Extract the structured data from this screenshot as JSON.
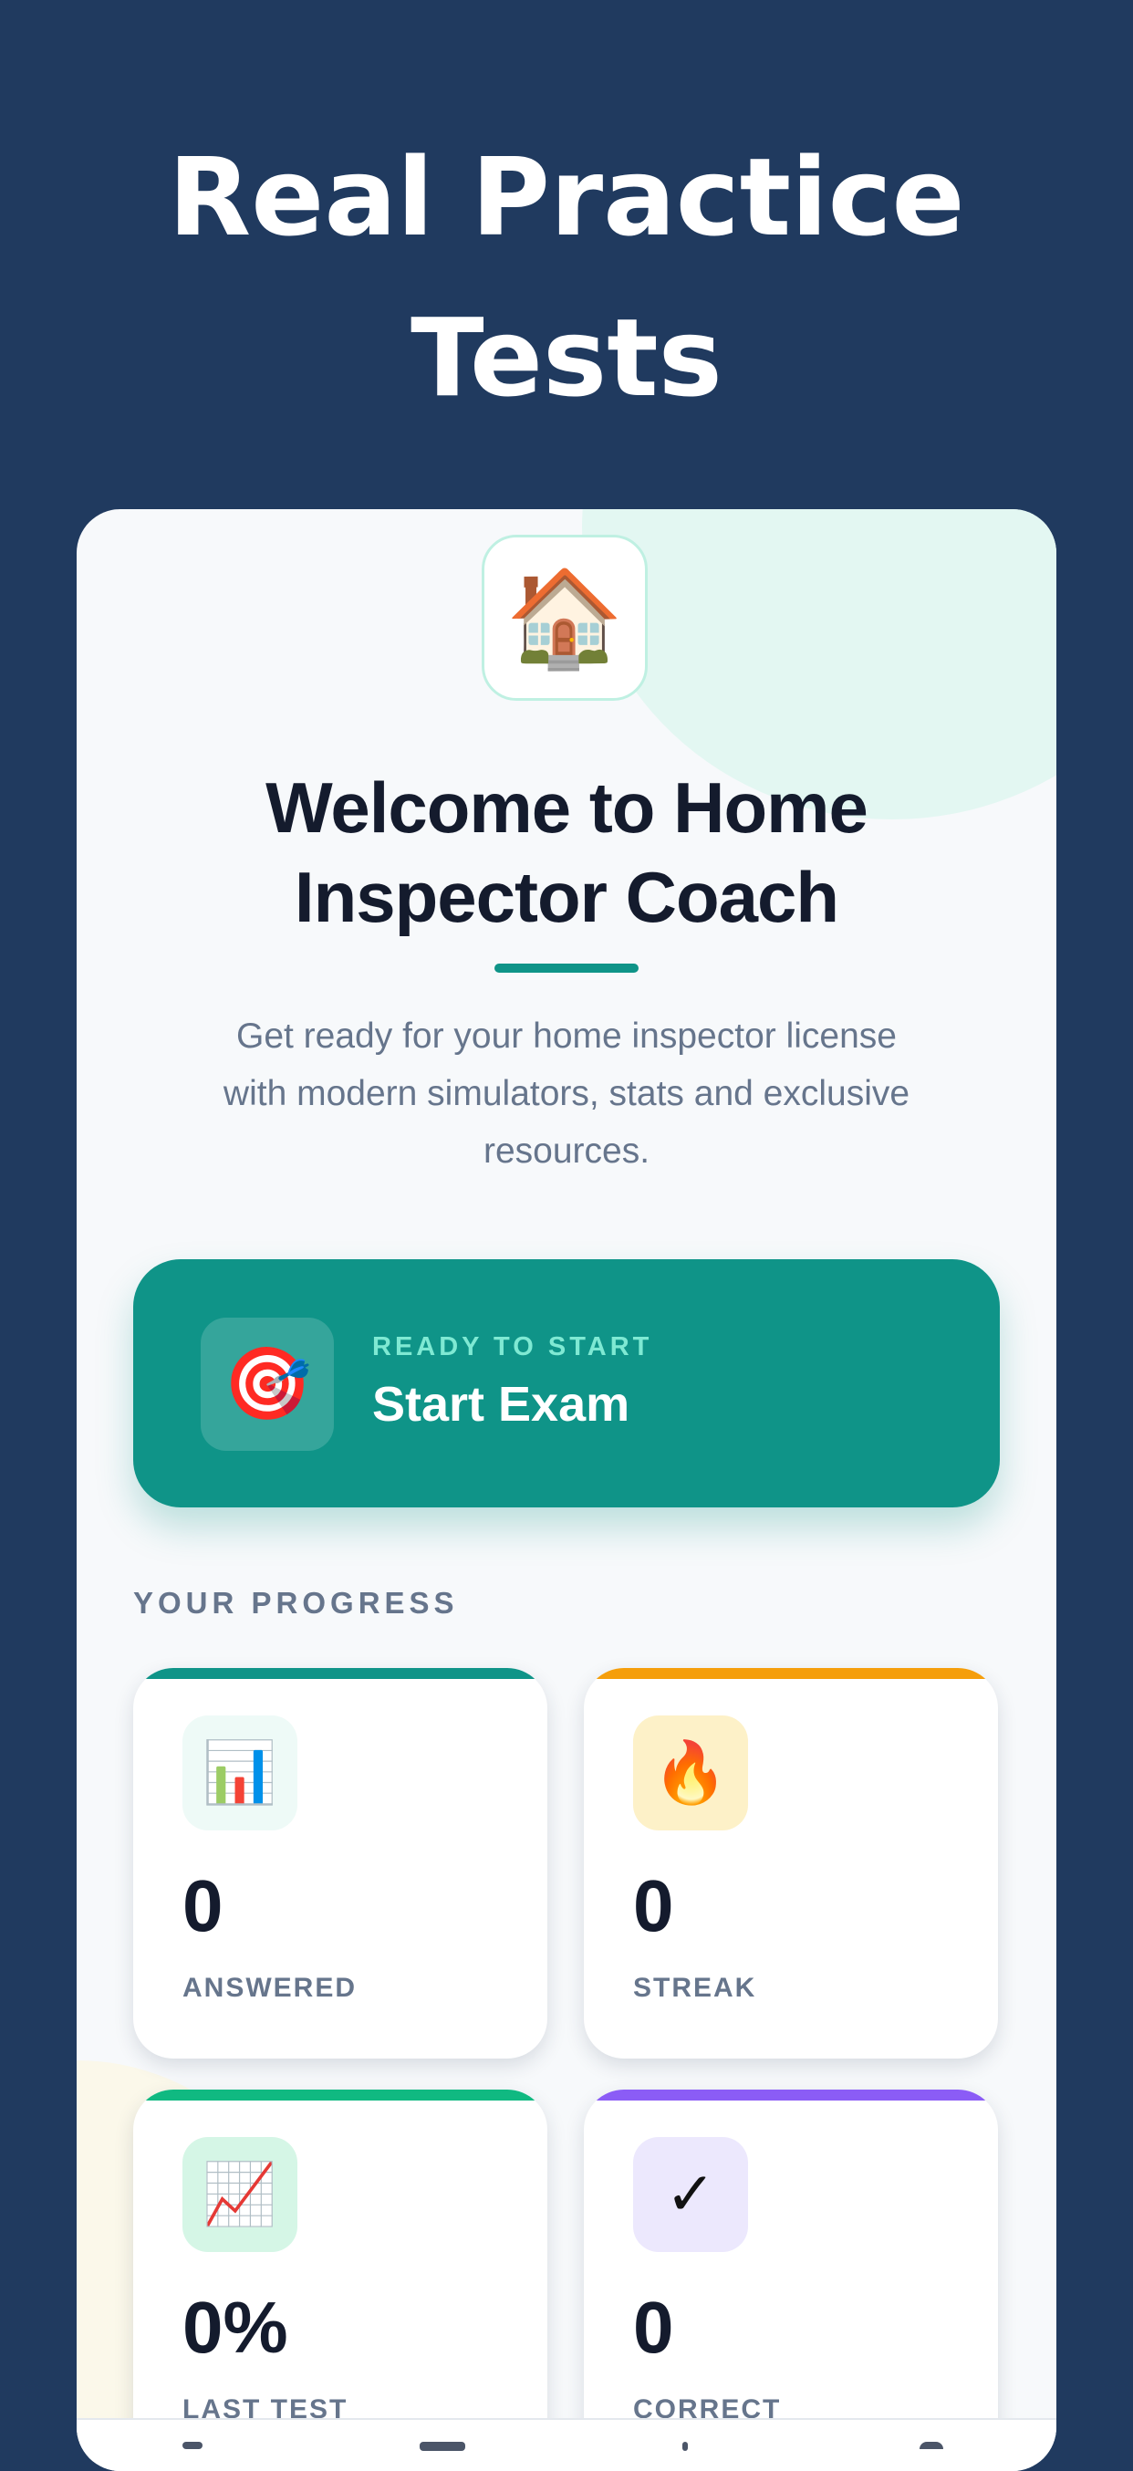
{
  "hero": {
    "title_line1": "Real Practice",
    "title_line2": "Tests"
  },
  "app": {
    "icon": "house-icon",
    "icon_glyph": "🏠"
  },
  "welcome": {
    "title_line1": "Welcome to Home",
    "title_line2": "Inspector Coach",
    "subtitle_line1": "Get ready for your home inspector license",
    "subtitle_line2": "with modern simulators, stats and exclusive",
    "subtitle_line3": "resources."
  },
  "start_card": {
    "icon": "target-icon",
    "icon_glyph": "🎯",
    "eyebrow": "READY TO START",
    "label": "Start Exam"
  },
  "progress": {
    "section_title": "YOUR PROGRESS",
    "stats": [
      {
        "icon": "bar-chart-icon",
        "icon_glyph": "📊",
        "value": "0",
        "label": "ANSWERED",
        "accent_color": "#0f9488",
        "icon_bg": "#eefaf7"
      },
      {
        "icon": "fire-icon",
        "icon_glyph": "🔥",
        "value": "0",
        "label": "STREAK",
        "accent_color": "#f59e0b",
        "icon_bg": "#fdf1c8"
      },
      {
        "icon": "trend-up-icon",
        "icon_glyph": "📈",
        "value": "0%",
        "label": "LAST TEST",
        "accent_color": "#10b981",
        "icon_bg": "#d5f6e6"
      },
      {
        "icon": "checkmark-icon",
        "icon_glyph": "✓",
        "value": "0",
        "label": "CORRECT",
        "accent_color": "#8b5cf6",
        "icon_bg": "#ece8fd"
      }
    ]
  },
  "colors": {
    "background": "#203a5f",
    "brand_teal": "#0f9488",
    "text_dark": "#141b2d",
    "text_muted": "#66758c"
  }
}
